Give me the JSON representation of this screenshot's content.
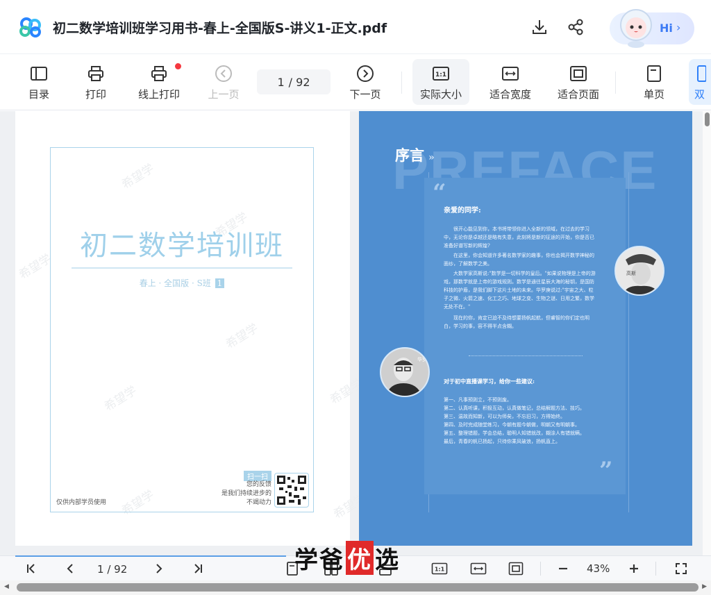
{
  "header": {
    "title": "初二数学培训班学习用书-春上-全国版S-讲义1-正文.pdf",
    "assistant_label": "Hi"
  },
  "toolbar": {
    "items": [
      {
        "label": "目录",
        "icon": "toc-icon"
      },
      {
        "label": "打印",
        "icon": "print-icon"
      },
      {
        "label": "线上打印",
        "icon": "online-print-icon"
      },
      {
        "label": "上一页",
        "icon": "prev-page-icon"
      },
      {
        "label": "下一页",
        "icon": "next-page-icon"
      },
      {
        "label": "实际大小",
        "icon": "actual-size-icon"
      },
      {
        "label": "适合宽度",
        "icon": "fit-width-icon"
      },
      {
        "label": "适合页面",
        "icon": "fit-page-icon"
      },
      {
        "label": "单页",
        "icon": "single-page-icon"
      },
      {
        "label": "双",
        "icon": "double-page-icon"
      }
    ],
    "current_page": "1",
    "total_pages": "/ 92"
  },
  "cover": {
    "title": "初二数学培训班",
    "subtitle": "春上 · 全国版 · S班",
    "badge": "1",
    "watermark": "希望学",
    "internal_note": "仅供内部学员使用",
    "qr_label": "扫一扫",
    "qr_text_1": "您的反馈",
    "qr_text_2": "是我们持续进步的",
    "qr_text_3": "不竭动力"
  },
  "preface": {
    "big_word": "PREFACE",
    "title": "序言",
    "chevron": "»",
    "greeting": "亲爱的同学:",
    "paragraphs": [
      "很开心能见到你，本书将带领你进入全新的领域，在过去的学习中，无论你是卓越还是略有失意，此刻将是新的征途的开始，你是否已准备好谱写新的辉煌?",
      "在这里，你会知道许多著名数学家的趣事，你也会揭开数学神秘的面纱，了解数学之美。",
      "大数学家高斯说:\"数学是一切科学的皇后。\"如果说物理是上帝的游戏，那数学就是上帝的游戏规则。数学是通往星辰大海的秘钥，是国防科技的护盾，是我们脚下这片土地的未来。华罗庚说过:\"宇宙之大、粒子之微、火箭之速、化工之巧、地球之变、生物之谜、日用之繁，数学无处不在。\"",
      "现在的你，肯定已迫不及待想要扬帆起航，但睿智的你们定也明白，学习的事，容不得半点含糊。"
    ],
    "advice_heading": "对于初中直播课学习，给你一些建议:",
    "advice": [
      "第一、凡事预则立，不预则废。",
      "第二、认真听课，积极互动，认真做笔记，总结解题方法、技巧。",
      "第三、温故而知新，可以为师矣，不忘旧习，方得始终。",
      "第四、及时完成随堂练习，今朝有题今朝做，明朝又有明朝事。",
      "第五、整理错题，学会总结，聪明人知错就改，糊涂人有错就瞒。",
      "最后，青春的帆已扬起，只待你乘风破浪，扬帆直上。"
    ],
    "portrait_top_caption": "高斯",
    "portrait_bottom_caption": "华罗庚"
  },
  "bottombar": {
    "current_page": "1",
    "total_pages": "/ 92",
    "zoom": "43%",
    "progress": 0.05,
    "brand_a": "学爸",
    "brand_b": "优",
    "brand_c": "选"
  },
  "colors": {
    "accent": "#2d7ff9",
    "cover_text": "#9fd0ea",
    "preface_bg": "#4f8ed0",
    "brand_red": "#e02a2a"
  }
}
